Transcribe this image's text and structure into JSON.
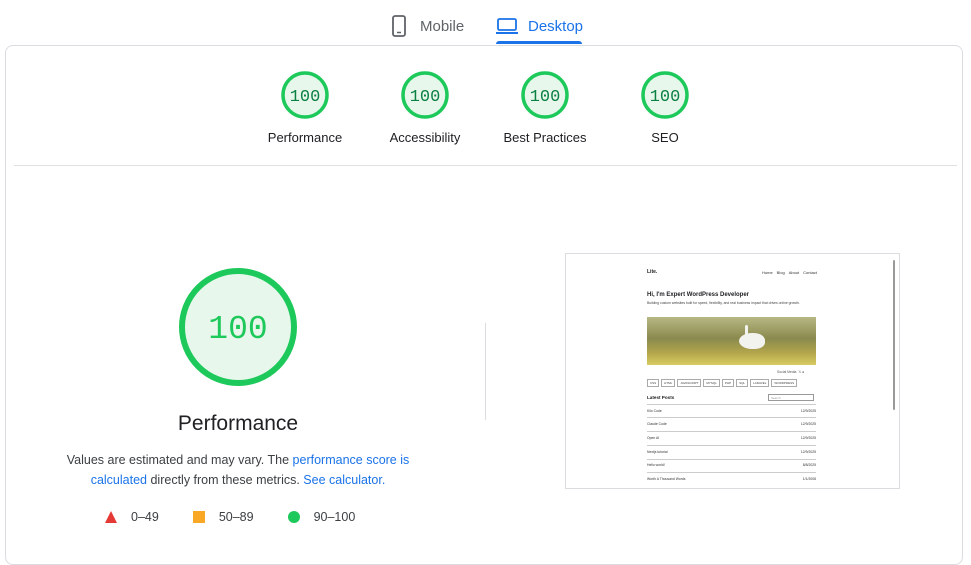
{
  "tabs": [
    {
      "label": "Mobile",
      "icon": "phone-icon",
      "active": false
    },
    {
      "label": "Desktop",
      "icon": "laptop-icon",
      "active": true
    }
  ],
  "categories": [
    {
      "score": "100",
      "label": "Performance"
    },
    {
      "score": "100",
      "label": "Accessibility"
    },
    {
      "score": "100",
      "label": "Best Practices"
    },
    {
      "score": "100",
      "label": "SEO"
    }
  ],
  "main": {
    "score": "100",
    "title": "Performance",
    "desc_prefix": "Values are estimated and may vary. The ",
    "desc_link1": "performance score is calculated",
    "desc_mid": " directly from these metrics. ",
    "desc_link2": "See calculator.",
    "desc_suffix": ""
  },
  "legend": [
    {
      "range": "0–49",
      "shape": "triangle",
      "color": "#e53935"
    },
    {
      "range": "50–89",
      "shape": "square",
      "color": "#f9a825"
    },
    {
      "range": "90–100",
      "shape": "circle",
      "color": "#1ec95b"
    }
  ],
  "colors": {
    "pass": "#1ec95b",
    "pass_bg": "#e8f7ec",
    "pass_text": "#0b8043",
    "accent": "#1a73e8"
  },
  "screenshot": {
    "logo": "Lite.",
    "nav": [
      "Home",
      "Blog",
      "About",
      "Contact"
    ],
    "heading": "Hi, I'm Expert WordPress Developer",
    "subtext": "Building custom websites built for speed, flexibility, and real business impact that drives online growth.",
    "social": "Social Media",
    "tags": [
      "CSS",
      "HTML",
      "JAVASCRIPT",
      "MYSQL",
      "PHP",
      "SQL",
      "LARAVEL",
      "WORDPRESS"
    ],
    "latest": "Latest Posts",
    "search_placeholder": "Search",
    "posts": [
      {
        "title": "Kilo Code",
        "date": "12/9/2025"
      },
      {
        "title": "Claude Code",
        "date": "12/9/2025"
      },
      {
        "title": "Open AI",
        "date": "12/9/2025"
      },
      {
        "title": "Nextjs tutorial",
        "date": "12/9/2025"
      },
      {
        "title": "Hello world!",
        "date": "8/8/2025"
      },
      {
        "title": "Worth A Thousand Words",
        "date": "1/1/2008"
      }
    ]
  }
}
